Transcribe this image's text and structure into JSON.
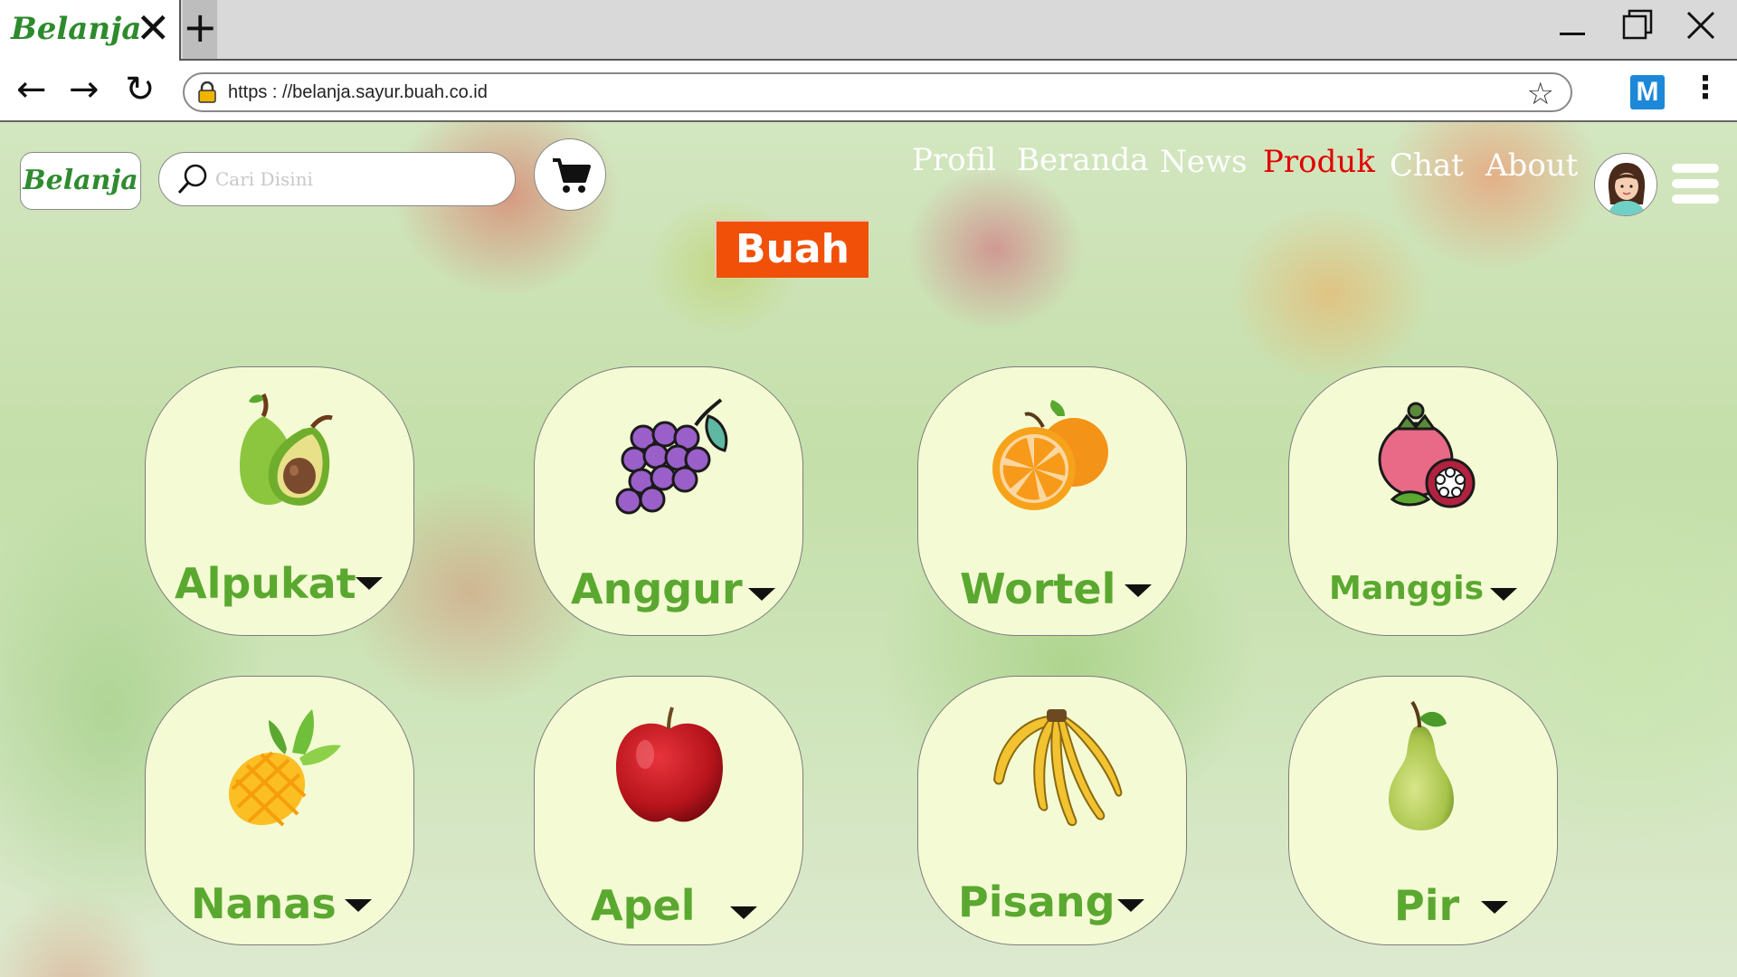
{
  "browser": {
    "tab": {
      "title": "Belanja",
      "close_glyph": "✕"
    },
    "new_tab_glyph": "+",
    "window_controls": [
      "minimize-icon",
      "restore-icon",
      "close-icon"
    ],
    "nav": {
      "back": "←",
      "forward": "→",
      "reload": "↻"
    },
    "url": "https : //belanja.sayur.buah.co.id",
    "star_glyph": "☆",
    "extension_label": "M",
    "menu_glyph": "⋮"
  },
  "site": {
    "logo": "Belanja",
    "search": {
      "placeholder": "Cari Disini",
      "value": ""
    },
    "menu": [
      {
        "label": "Profil",
        "active": false
      },
      {
        "label": "Beranda",
        "active": false
      },
      {
        "label": "News",
        "active": false
      },
      {
        "label": "Produk",
        "active": true
      },
      {
        "label": "Chat",
        "active": false
      },
      {
        "label": "About",
        "active": false
      }
    ],
    "colors": {
      "active_menu": "#e00000",
      "section_bg": "#f05008",
      "card_bg": "#f4fbd4",
      "label_green": "#5aa830"
    }
  },
  "section": {
    "title": "Buah"
  },
  "products": [
    {
      "name": "Alpukat",
      "icon": "avocado-icon"
    },
    {
      "name": "Anggur",
      "icon": "grapes-icon"
    },
    {
      "name": "Wortel",
      "icon": "orange-icon"
    },
    {
      "name": "Manggis",
      "icon": "mangosteen-icon"
    },
    {
      "name": "Nanas",
      "icon": "pineapple-icon"
    },
    {
      "name": "Apel",
      "icon": "apple-icon"
    },
    {
      "name": "Pisang",
      "icon": "banana-icon"
    },
    {
      "name": "Pir",
      "icon": "pear-icon"
    }
  ]
}
